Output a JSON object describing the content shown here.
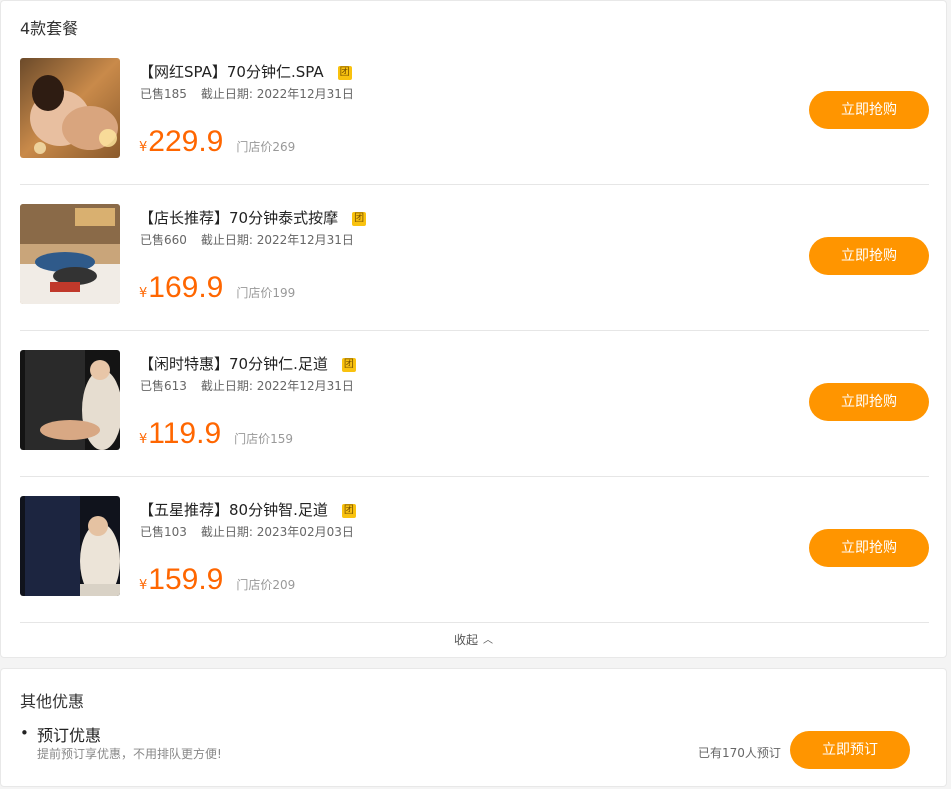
{
  "packages": {
    "title": "4款套餐",
    "badge": "团",
    "currency": "¥",
    "items": [
      {
        "name": "【网红SPA】70分钟仁.SPA",
        "sold": "已售185",
        "deadline": "截止日期: 2022年12月31日",
        "price": "229.9",
        "store_price": "门店价269",
        "button": "立即抢购",
        "image": "spa-massage-photo"
      },
      {
        "name": "【店长推荐】70分钟泰式按摩",
        "sold": "已售660",
        "deadline": "截止日期: 2022年12月31日",
        "price": "169.9",
        "store_price": "门店价199",
        "button": "立即抢购",
        "image": "thai-massage-photo"
      },
      {
        "name": "【闲时特惠】70分钟仁.足道",
        "sold": "已售613",
        "deadline": "截止日期: 2022年12月31日",
        "price": "119.9",
        "store_price": "门店价159",
        "button": "立即抢购",
        "image": "foot-massage-photo"
      },
      {
        "name": "【五星推荐】80分钟智.足道",
        "sold": "已售103",
        "deadline": "截止日期: 2023年02月03日",
        "price": "159.9",
        "store_price": "门店价209",
        "button": "立即抢购",
        "image": "foot-massage-photo-2"
      }
    ],
    "collapse_label": "收起"
  },
  "other_offers": {
    "title": "其他优惠",
    "offer": {
      "bullet": "•",
      "name": "预订优惠",
      "description": "提前预订享优惠，不用排队更方便!",
      "count": "已有170人预订",
      "button": "立即预订"
    }
  },
  "colors": {
    "accent": "#ff9500",
    "price": "#ff6600",
    "badge": "#f9c20f"
  }
}
